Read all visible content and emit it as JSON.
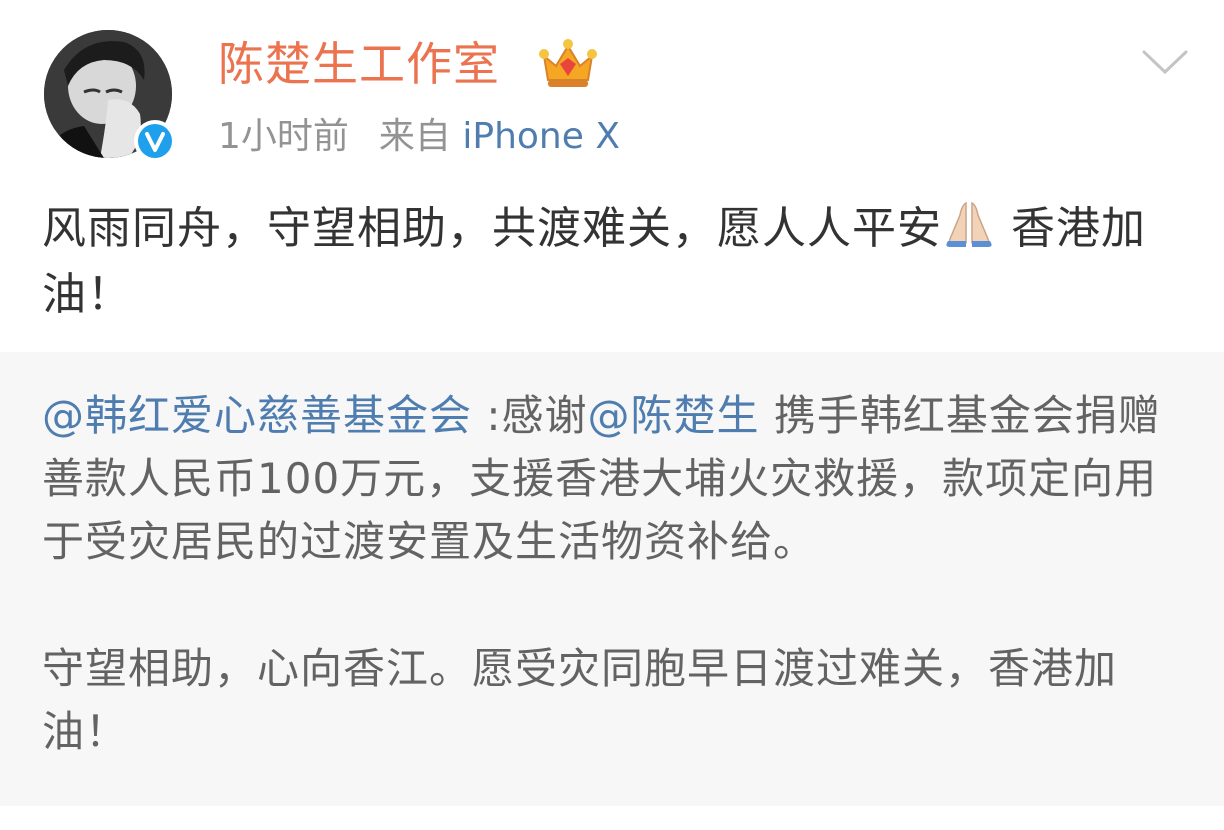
{
  "user": {
    "name": "陈楚生工作室",
    "time": "1小时前",
    "source_prefix": "来自",
    "source": "iPhone X"
  },
  "post": {
    "text_before_emoji": "风雨同舟，守望相助，共渡难关，愿人人平安",
    "text_after_emoji": " 香港加油！"
  },
  "repost": {
    "mention_foundation": "@韩红爱心慈善基金会",
    "colon_thanks": " :感谢",
    "mention_person": "@陈楚生",
    "body_1": " 携手韩红基金会捐赠善款人民币100万元，支援香港大埔火灾救援，款项定向用于受灾居民的过渡安置及生活物资补给。",
    "body_2": "守望相助，心向香江。愿受灾同胞早日渡过难关，香港加油！"
  },
  "colors": {
    "name": "#eb7350",
    "link": "#507daf",
    "meta": "#939393",
    "repost_bg": "#f7f7f7"
  },
  "icons": {
    "verified": "verified-badge-icon",
    "crown": "crown-member-icon",
    "pray": "folded-hands-emoji",
    "more": "chevron-down-icon"
  }
}
